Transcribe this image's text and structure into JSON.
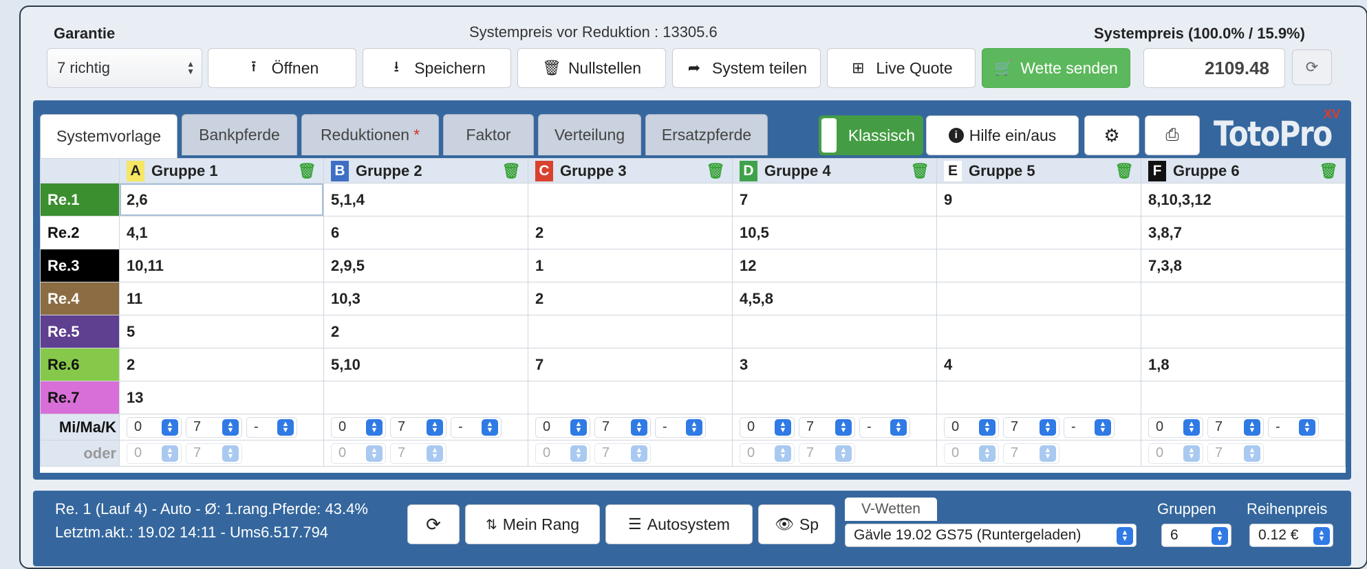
{
  "header": {
    "garantie_label": "Garantie",
    "garantie_value": "7 richtig",
    "preis_vor_reduktion": "Systempreis vor Reduktion : 13305.6",
    "systempreis_label": "Systempreis (100.0% / 15.9%)",
    "systempreis_value": "2109.48",
    "buttons": {
      "open": "Öffnen",
      "save": "Speichern",
      "reset": "Nullstellen",
      "share": "System teilen",
      "live": "Live Quote",
      "send": "Wette senden"
    },
    "icons": {
      "open": "upload-icon",
      "save": "download-icon",
      "reset": "trash-icon",
      "share": "share-arrow-icon",
      "live": "gift-icon",
      "send": "cart-icon",
      "refresh": "refresh-icon"
    }
  },
  "tabs": [
    "Systemvorlage",
    "Bankpferde",
    "Reduktionen",
    "Faktor",
    "Verteilung",
    "Ersatzpferde"
  ],
  "tab_star": "*",
  "toolbar": {
    "klassisch": "Klassisch",
    "help": "Hilfe ein/aus",
    "logo_text": "TotoPro",
    "logo_superscript": "XV"
  },
  "groups": [
    {
      "letter": "A",
      "name": "Gruppe 1",
      "color": "#f5e663",
      "text_color": "#222"
    },
    {
      "letter": "B",
      "name": "Gruppe 2",
      "color": "#3f6fc4",
      "text_color": "#fff"
    },
    {
      "letter": "C",
      "name": "Gruppe 3",
      "color": "#d9412f",
      "text_color": "#fff"
    },
    {
      "letter": "D",
      "name": "Gruppe 4",
      "color": "#3fa24a",
      "text_color": "#fff"
    },
    {
      "letter": "E",
      "name": "Gruppe 5",
      "color": "#ffffff",
      "text_color": "#222"
    },
    {
      "letter": "F",
      "name": "Gruppe 6",
      "color": "#111111",
      "text_color": "#fff"
    }
  ],
  "rows": [
    {
      "label": "Re.1",
      "color": "#3b8f2f",
      "text_color": "#fff",
      "cells": [
        "2,6",
        "5,1,4",
        "",
        "7",
        "9",
        "8,10,3,12"
      ]
    },
    {
      "label": "Re.2",
      "color": "#ffffff",
      "text_color": "#111",
      "cells": [
        "4,1",
        "6",
        "2",
        "10,5",
        "",
        "3,8,7"
      ]
    },
    {
      "label": "Re.3",
      "color": "#000000",
      "text_color": "#fff",
      "cells": [
        "10,11",
        "2,9,5",
        "1",
        "12",
        "",
        "7,3,8"
      ]
    },
    {
      "label": "Re.4",
      "color": "#8b6c43",
      "text_color": "#fff",
      "cells": [
        "11",
        "10,3",
        "2",
        "4,5,8",
        "",
        ""
      ]
    },
    {
      "label": "Re.5",
      "color": "#5f3f8f",
      "text_color": "#fff",
      "cells": [
        "5",
        "2",
        "",
        "",
        "",
        ""
      ]
    },
    {
      "label": "Re.6",
      "color": "#86c94a",
      "text_color": "#111",
      "cells": [
        "2",
        "5,10",
        "7",
        "3",
        "4",
        "1,8"
      ]
    },
    {
      "label": "Re.7",
      "color": "#d86fd8",
      "text_color": "#111",
      "cells": [
        "13",
        "",
        "",
        "",
        "",
        ""
      ]
    }
  ],
  "mimak": {
    "label": "Mi/Ma/K",
    "oder_label": "oder",
    "values": [
      "0",
      "7",
      "-"
    ],
    "oder_values": [
      "0",
      "7"
    ]
  },
  "bottom": {
    "info_line1": "Re. 1 (Lauf 4) - Auto - Ø: 1.rang.Pferde: 43.4%",
    "info_line2": "Letztm.akt.: 19.02 14:11 - Ums6.517.794",
    "mein_rang": "Mein Rang",
    "autosystem": "Autosystem",
    "sp": "Sp",
    "vwetten_tab": "V-Wetten",
    "race_select": "Gävle 19.02 GS75 (Runtergeladen)",
    "gruppen_label": "Gruppen",
    "gruppen_value": "6",
    "reihenpreis_label": "Reihenpreis",
    "reihenpreis_value": "0.12 €"
  }
}
